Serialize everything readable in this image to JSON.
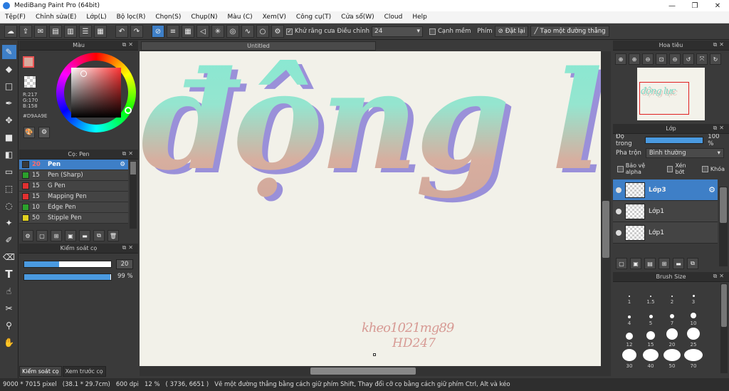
{
  "window": {
    "title": "MediBang Paint Pro (64bit)",
    "minimize": "—",
    "maximize": "❐",
    "close": "✕"
  },
  "menu": [
    "Tệp(F)",
    "Chỉnh sửa(E)",
    "Lớp(L)",
    "Bộ lọc(R)",
    "Chọn(S)",
    "Chụp(N)",
    "Màu (C)",
    "Xem(V)",
    "Công cụ(T)",
    "Cửa sổ(W)",
    "Cloud",
    "Help"
  ],
  "toolbar": {
    "antialias_label": "Khử răng cưa",
    "adjust_label": "Điều chỉnh",
    "adjust_value": "24",
    "edge_label": "Cạnh mềm",
    "key_label": "Phím",
    "set_label": "Đặt lại",
    "line_label": "Tạo một đường thẳng"
  },
  "color_panel": {
    "title": "Màu",
    "r": "R:217",
    "g": "G:170",
    "b": "B:158",
    "hex": "#D9AA9E",
    "fg_color": "#D9AA9E"
  },
  "brush_panel": {
    "title": "Cọ: Pen",
    "items": [
      {
        "size": "20",
        "name": "Pen",
        "color": "#3a3a3a"
      },
      {
        "size": "15",
        "name": "Pen (Sharp)",
        "color": "#2ca02c"
      },
      {
        "size": "15",
        "name": "G Pen",
        "color": "#e03030"
      },
      {
        "size": "15",
        "name": "Mapping Pen",
        "color": "#e03030"
      },
      {
        "size": "10",
        "name": "Edge Pen",
        "color": "#2ca02c"
      },
      {
        "size": "50",
        "name": "Stipple Pen",
        "color": "#e0d020"
      }
    ]
  },
  "brush_control": {
    "title": "Kiểm soát cọ",
    "size_value": "20",
    "size_fraction": 0.4,
    "opacity_value": "99 %",
    "opacity_fraction": 0.99
  },
  "left_tabs": [
    "Kiểm soát cọ",
    "Xem trước cọ"
  ],
  "canvas": {
    "tab": "Untitled",
    "art_text": "động lực",
    "sig_line1": "kheo1021mg89",
    "sig_line2": "HD247"
  },
  "navigator": {
    "title": "Hoa tiêu",
    "thumb_text": "động lực"
  },
  "layer_panel": {
    "title": "Lớp",
    "opacity_label": "Độ trong",
    "opacity_value": "100 %",
    "blend_label": "Pha trộn",
    "blend_value": "Bình thường",
    "protect_alpha": "Bảo vệ alpha",
    "clipping": "Xén bớt",
    "lock": "Khóa",
    "layers": [
      {
        "name": "Lớp3",
        "selected": true
      },
      {
        "name": "Lớp1",
        "selected": false
      },
      {
        "name": "Lớp1",
        "selected": false
      }
    ]
  },
  "brush_size": {
    "title": "Brush Size",
    "sizes": [
      "1",
      "1.5",
      "2",
      "3",
      "4",
      "5",
      "7",
      "10",
      "12",
      "15",
      "20",
      "25",
      "30",
      "40",
      "50",
      "70"
    ]
  },
  "status": {
    "size": "9000 * 7015 pixel",
    "cm": "(38.1 * 29.7cm)",
    "dpi": "600 dpi",
    "zoom": "12 %",
    "coords": "( 3736, 6651 )",
    "hint": "Vẽ một đường thẳng bằng cách giữ phím Shift, Thay đổi cỡ cọ bằng cách giữ phím Ctrl, Alt và kéo"
  }
}
